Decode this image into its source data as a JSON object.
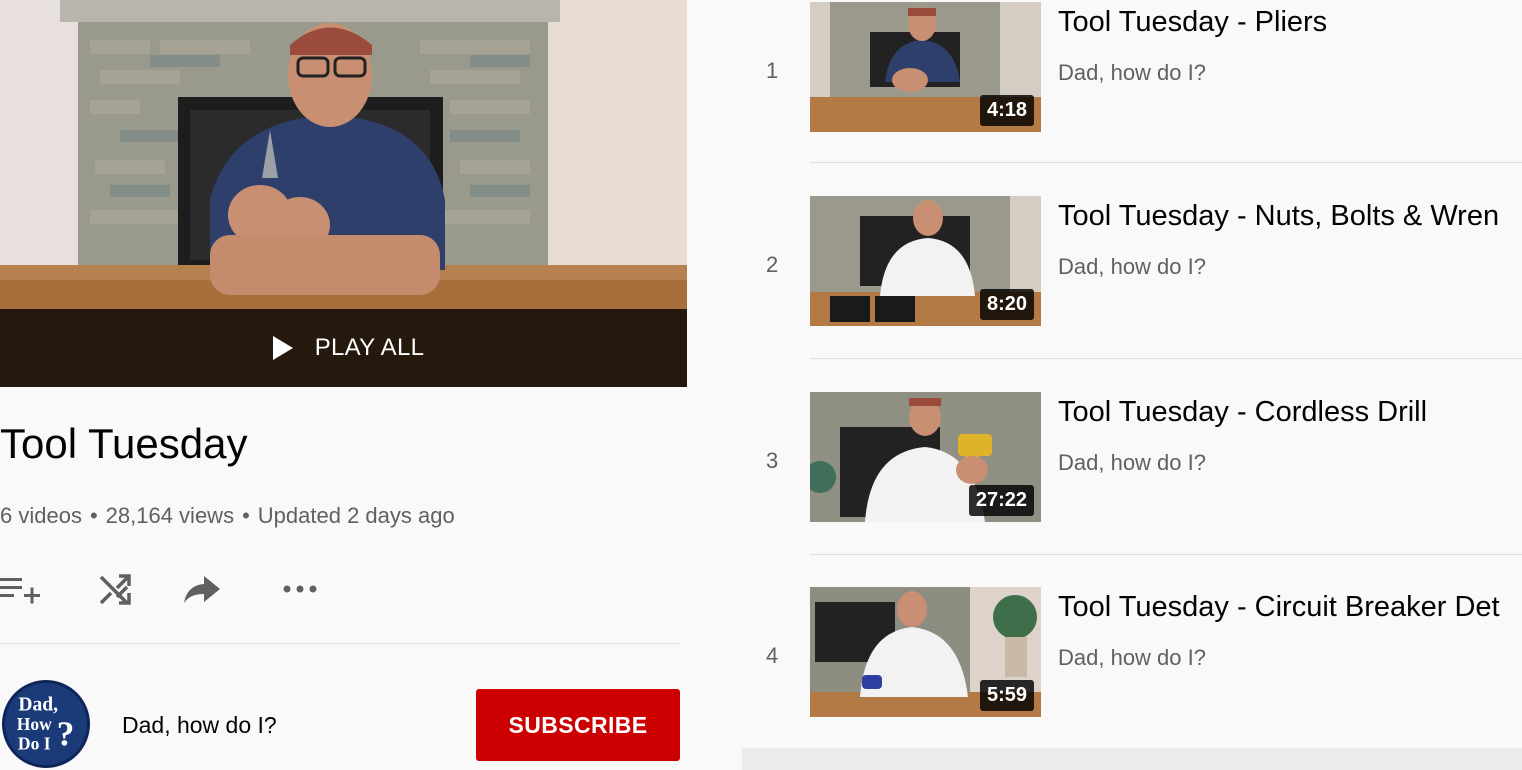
{
  "hero": {
    "play_all_label": "PLAY ALL"
  },
  "playlist": {
    "title": "Tool Tuesday",
    "video_count": "6 videos",
    "views": "28,164 views",
    "updated": "Updated 2 days ago",
    "separator": "•"
  },
  "actions": {
    "icons": [
      "add-to-queue-icon",
      "shuffle-icon",
      "share-icon",
      "more-icon"
    ]
  },
  "channel": {
    "name": "Dad, how do I?",
    "avatar_text_1": "Dad,",
    "avatar_text_2": "How",
    "avatar_text_3": "Do I",
    "avatar_q": "?",
    "subscribe_label": "SUBSCRIBE"
  },
  "colors": {
    "subscribe_bg": "#cc0000",
    "page_bg": "#f9f9f9",
    "secondary_text": "#606060"
  },
  "videos": [
    {
      "index": "1",
      "title": "Tool Tuesday - Pliers",
      "channel": "Dad, how do I?",
      "duration": "4:18"
    },
    {
      "index": "2",
      "title": "Tool Tuesday - Nuts, Bolts & Wren",
      "channel": "Dad, how do I?",
      "duration": "8:20"
    },
    {
      "index": "3",
      "title": "Tool Tuesday - Cordless Drill",
      "channel": "Dad, how do I?",
      "duration": "27:22"
    },
    {
      "index": "4",
      "title": "Tool Tuesday - Circuit Breaker Det",
      "channel": "Dad, how do I?",
      "duration": "5:59"
    }
  ]
}
